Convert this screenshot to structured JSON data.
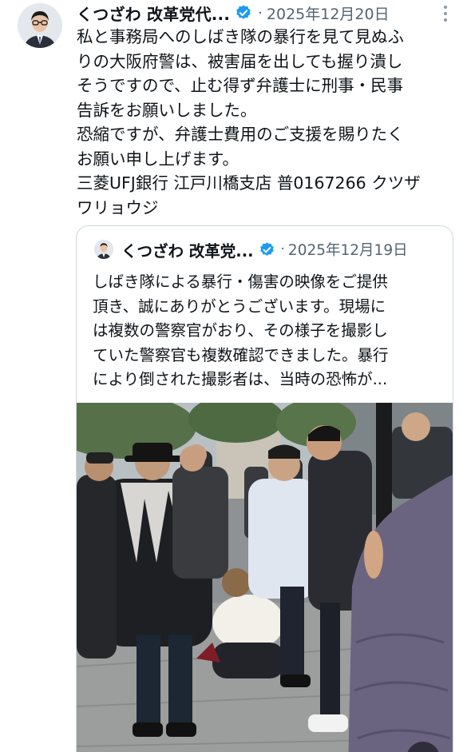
{
  "tweet": {
    "author_name": "くつざわ 改革党代...",
    "separator": "·",
    "date": "2025年12月20日",
    "body": "私と事務局へのしばき隊の暴行を見て見ぬふ\nりの大阪府警は、被害届を出しても握り潰し\nそうですので、止む得ず弁護士に刑事・民事\n告訴をお願いしました。\n恐縮ですが、弁護士費用のご支援を賜りたく\nお願い申し上げます。\n三菱UFJ銀行 江戸川橋支店 普0167266 クツザ\nワリョウジ"
  },
  "quoted_tweet": {
    "author_name": "くつざわ 改革党...",
    "separator": "·",
    "date": "2025年12月19日",
    "body": "しばき隊による暴行・傷害の映像をご提供\n頂き、誠にありがとうございます。現場に\nは複数の警察官がおり、その様子を撮影し\nていた警察官も複数確認できました。暴行\nにより倒された撮影者は、当時の恐怖が..."
  },
  "colors": {
    "verified_blue": "#1d9bf0",
    "secondary_text": "#536471",
    "border": "#cfd9de"
  },
  "icons": {
    "verified": "verified-badge-icon",
    "more": "more-options-icon",
    "mute": "volume-icon"
  }
}
